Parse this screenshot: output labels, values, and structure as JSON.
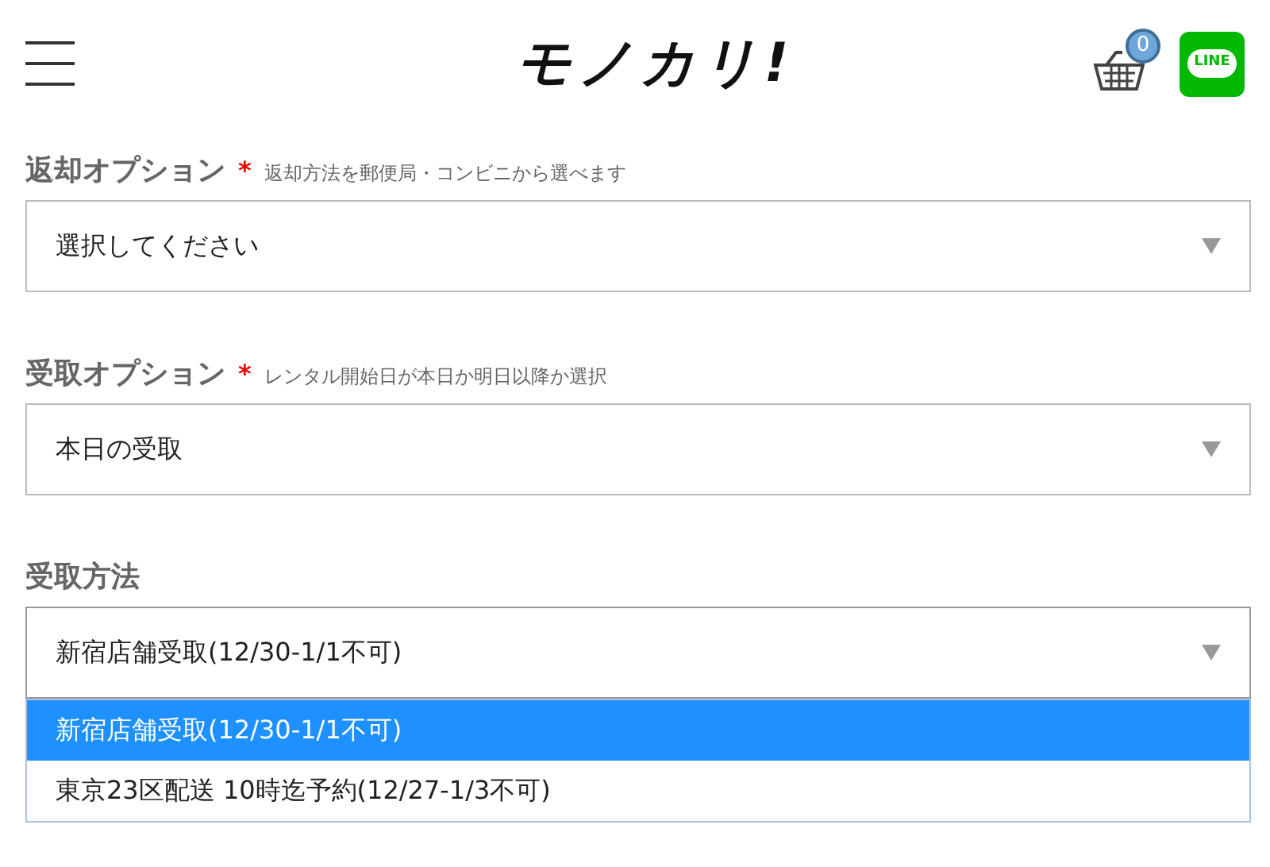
{
  "header": {
    "logo": "モノカリ!",
    "cart_count": "0",
    "line_badge": "LINE"
  },
  "fields": [
    {
      "label": "返却オプション",
      "required_mark": "*",
      "hint": "返却方法を郵便局・コンビニから選べます",
      "value": "選択してください"
    },
    {
      "label": "受取オプション",
      "required_mark": "*",
      "hint": "レンタル開始日が本日か明日以降か選択",
      "value": "本日の受取"
    },
    {
      "label": "受取方法",
      "value": "新宿店舗受取(12/30-1/1不可)",
      "expanded": true,
      "options": [
        {
          "label": "新宿店舗受取(12/30-1/1不可)",
          "selected": true
        },
        {
          "label": "東京23区配送 10時迄予約(12/27-1/3不可)",
          "selected": false
        }
      ]
    }
  ]
}
